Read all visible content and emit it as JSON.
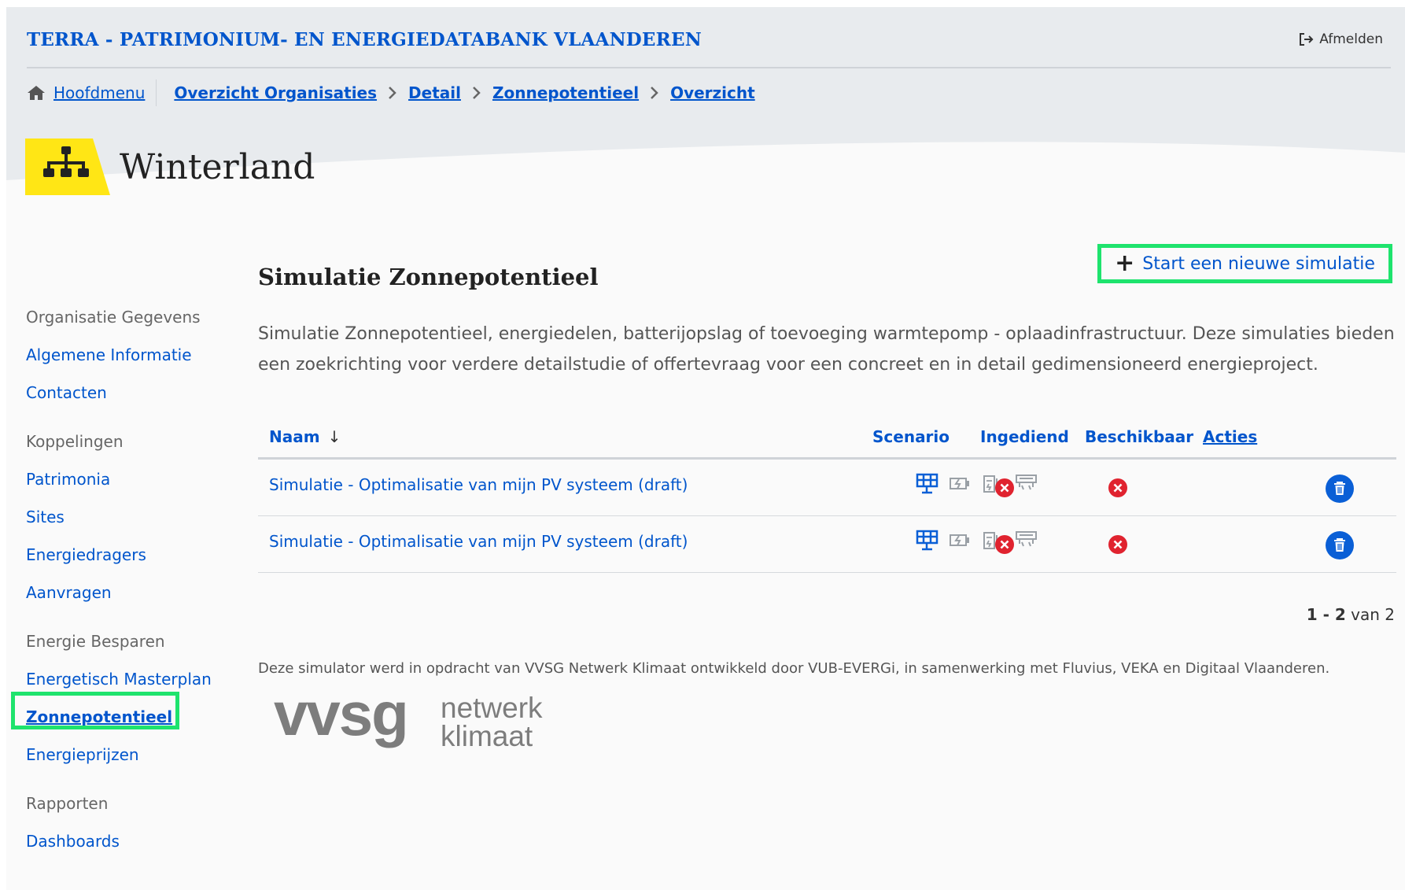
{
  "header": {
    "app_title": "TERRA - PATRIMONIUM- EN ENERGIEDATABANK VLAANDEREN",
    "logout_label": "Afmelden"
  },
  "breadcrumb": {
    "home_label": "Hoofdmenu",
    "items": [
      "Overzicht Organisaties",
      "Detail",
      "Zonnepotentieel",
      "Overzicht"
    ]
  },
  "organization": {
    "name": "Winterland",
    "badge_color": "#ffe615",
    "badge_icon": "org-chart-icon"
  },
  "sidebar": {
    "groups": [
      {
        "label": "Organisatie Gegevens",
        "items": [
          "Algemene Informatie",
          "Contacten"
        ]
      },
      {
        "label": "Koppelingen",
        "items": [
          "Patrimonia",
          "Sites",
          "Energiedragers",
          "Aanvragen"
        ]
      },
      {
        "label": "Energie Besparen",
        "items": [
          "Energetisch Masterplan",
          "Zonnepotentieel",
          "Energieprijzen"
        ]
      },
      {
        "label": "Rapporten",
        "items": [
          "Dashboards"
        ]
      }
    ],
    "active_item": "Zonnepotentieel"
  },
  "main": {
    "heading": "Simulatie Zonnepotentieel",
    "new_simulation_label": "Start een nieuwe simulatie",
    "intro": "Simulatie Zonnepotentieel, energiedelen, batterijopslag of toevoeging warmtepomp - oplaadinfrastructuur. Deze simulaties bieden een zoekrichting voor verdere detailstudie of offertevraag voor een concreet en in detail gedimensioneerd energieproject."
  },
  "table": {
    "columns": {
      "name": "Naam",
      "sort_indicator": "↓",
      "scenario": "Scenario",
      "submitted": "Ingediend",
      "available": "Beschikbaar",
      "actions": "Acties"
    },
    "rows": [
      {
        "name": "Simulatie - Optimalisatie van mijn PV systeem (draft)",
        "scenario_icons": [
          "solar-panel-icon",
          "battery-icon",
          "heat-pump-icon",
          "charging-icon"
        ],
        "submitted": false,
        "available": false
      },
      {
        "name": "Simulatie - Optimalisatie van mijn PV systeem (draft)",
        "scenario_icons": [
          "solar-panel-icon",
          "battery-icon",
          "heat-pump-icon",
          "charging-icon"
        ],
        "submitted": false,
        "available": false
      }
    ]
  },
  "pagination": {
    "range": "1 - 2",
    "of_label": "van 2"
  },
  "footer": {
    "note": "Deze simulator werd in opdracht van VVSG Netwerk Klimaat ontwikkeld door VUB-EVERGi, in samenwerking met Fluvius, VEKA en Digitaal Vlaanderen.",
    "logo_main": "vvsg",
    "logo_line1": "netwerk",
    "logo_line2": "klimaat"
  },
  "colors": {
    "link": "#0055cc",
    "highlight": "#1ee36d",
    "status_no": "#e0232f",
    "delete": "#0a5fd6"
  }
}
